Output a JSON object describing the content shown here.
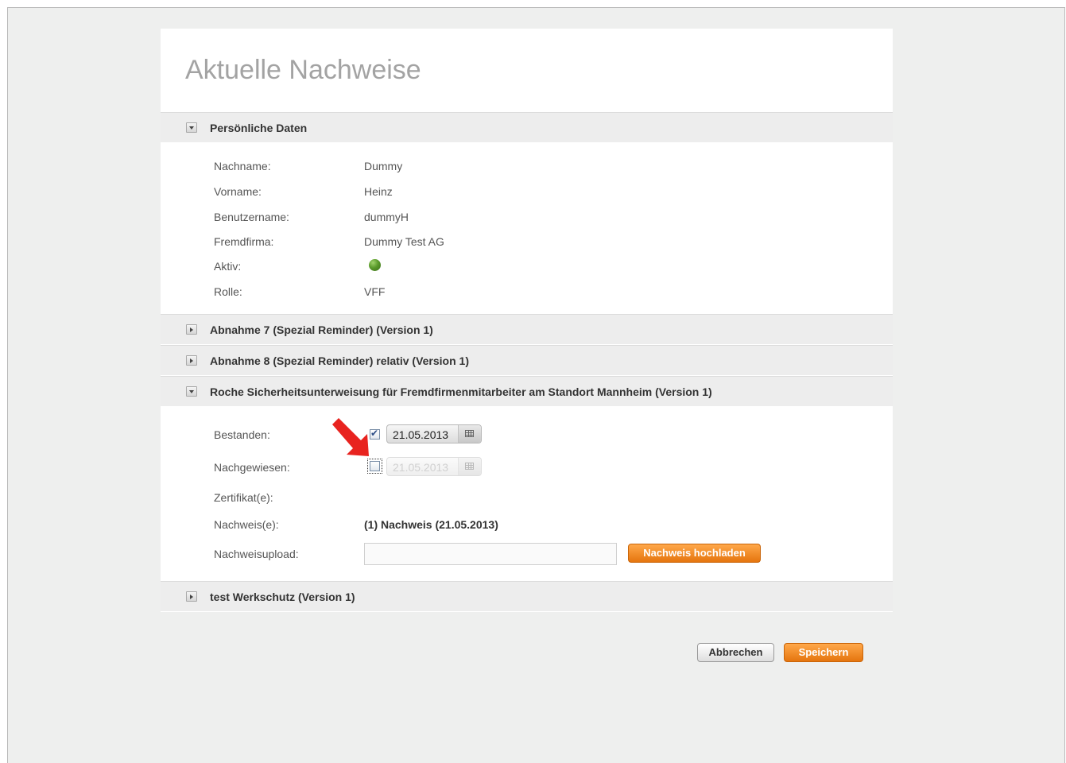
{
  "page": {
    "title": "Aktuelle Nachweise"
  },
  "sections": [
    {
      "title": "Persönliche Daten",
      "expanded": true
    },
    {
      "title": "Abnahme 7 (Spezial Reminder) (Version 1)",
      "expanded": false
    },
    {
      "title": "Abnahme 8 (Spezial Reminder) relativ (Version 1)",
      "expanded": false
    },
    {
      "title": "Roche Sicherheitsunterweisung für Fremdfirmenmitarbeiter am Standort Mannheim (Version 1)",
      "expanded": true
    },
    {
      "title": "test Werkschutz (Version 1)",
      "expanded": false
    }
  ],
  "personal": {
    "lastname_label": "Nachname:",
    "lastname": "Dummy",
    "firstname_label": "Vorname:",
    "firstname": "Heinz",
    "username_label": "Benutzername:",
    "username": "dummyH",
    "company_label": "Fremdfirma:",
    "company": "Dummy Test AG",
    "active_label": "Aktiv:",
    "active_status": "active",
    "role_label": "Rolle:",
    "role": "VFF"
  },
  "training": {
    "passed_label": "Bestanden:",
    "passed_checked": true,
    "passed_date": "21.05.2013",
    "proven_label": "Nachgewiesen:",
    "proven_checked": false,
    "proven_date": "21.05.2013",
    "certificate_label": "Zertifikat(e):",
    "evidence_label": "Nachweis(e):",
    "evidence_value": "(1) Nachweis (21.05.2013)",
    "upload_label": "Nachweisupload:",
    "upload_value": "",
    "upload_button": "Nachweis hochladen"
  },
  "actions": {
    "cancel": "Abbrechen",
    "save": "Speichern"
  },
  "colors": {
    "accent": "#f28a1f",
    "active_dot": "#5a9a2b",
    "annotation_arrow": "#e8231f"
  },
  "icons": {
    "collapsed": "chevron-right-icon",
    "expanded": "chevron-down-icon",
    "calendar": "calendar-icon"
  }
}
